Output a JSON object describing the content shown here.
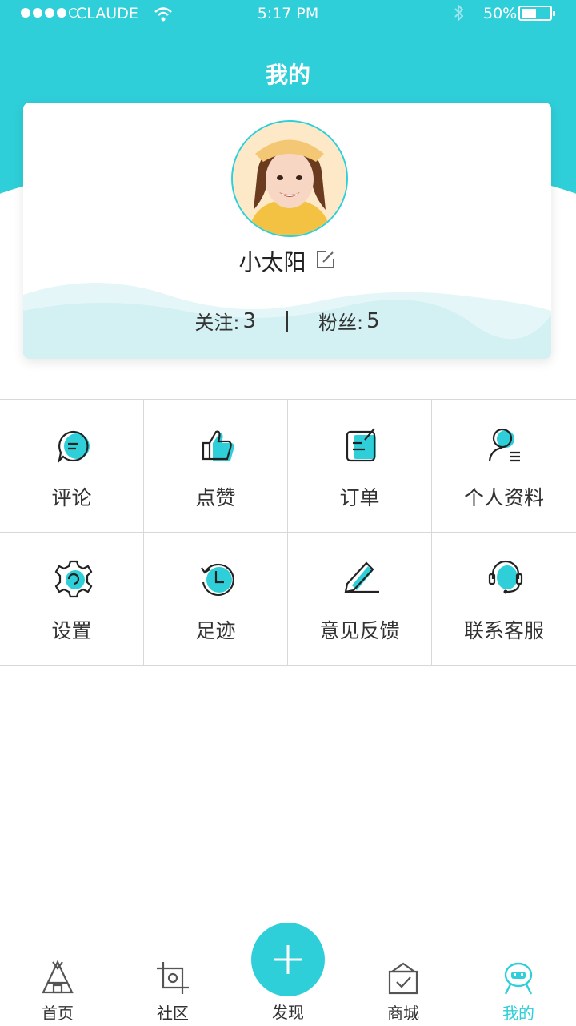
{
  "status_bar": {
    "carrier": "CLAUDE",
    "time": "5:17 PM",
    "battery": "50%"
  },
  "header": {
    "title": "我的"
  },
  "profile": {
    "username": "小太阳",
    "following_label": "关注:",
    "following_count": "3",
    "followers_label": "粉丝:",
    "followers_count": "5"
  },
  "menu": [
    {
      "label": "评论",
      "icon": "comment-icon"
    },
    {
      "label": "点赞",
      "icon": "thumbs-up-icon"
    },
    {
      "label": "订单",
      "icon": "order-icon"
    },
    {
      "label": "个人资料",
      "icon": "profile-icon"
    },
    {
      "label": "设置",
      "icon": "settings-icon"
    },
    {
      "label": "足迹",
      "icon": "history-icon"
    },
    {
      "label": "意见反馈",
      "icon": "feedback-icon"
    },
    {
      "label": "联系客服",
      "icon": "customer-service-icon"
    }
  ],
  "tabbar": {
    "home": "首页",
    "community": "社区",
    "discover": "发现",
    "mall": "商城",
    "mine": "我的"
  },
  "colors": {
    "accent": "#2ecfd9",
    "text": "#333333",
    "divider": "#d8d8d8"
  }
}
